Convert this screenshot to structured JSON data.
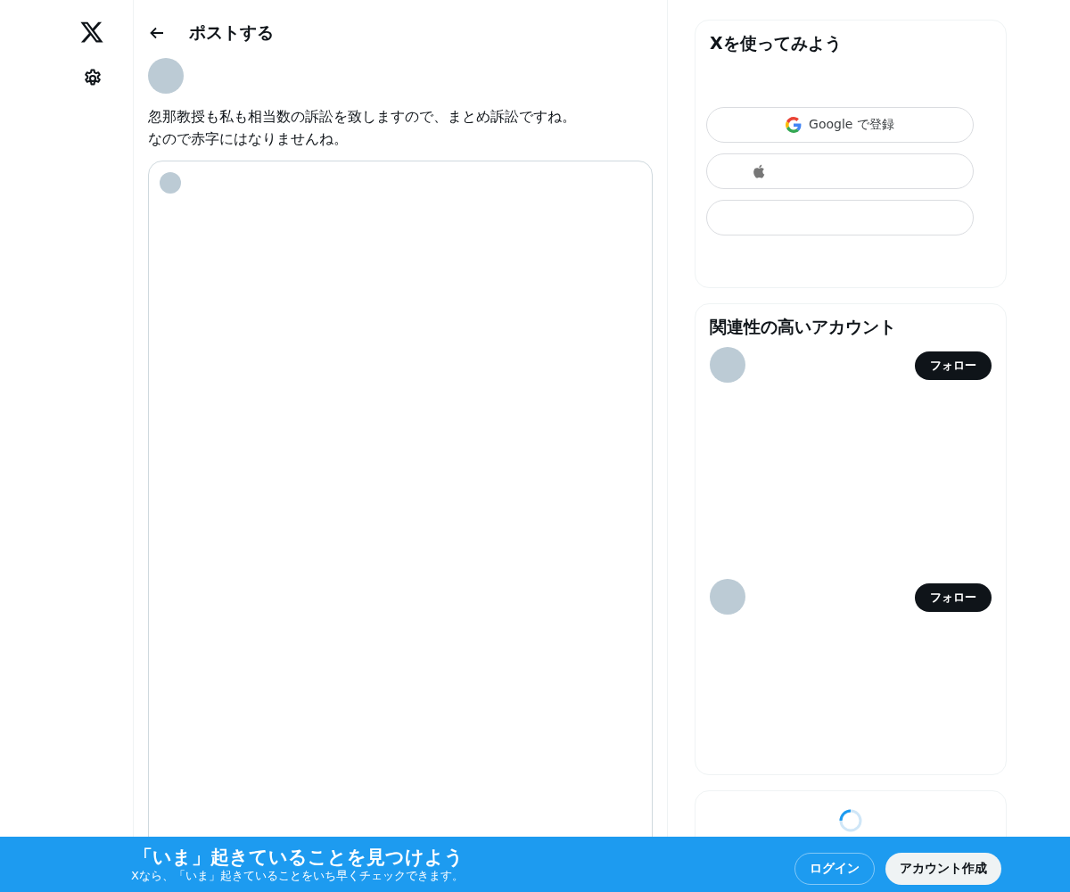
{
  "header": {
    "title": "ポストする"
  },
  "post": {
    "text_lines": [
      "忽那教授も私も相当数の訴訟を致しますので、まとめ訴訟ですね。",
      "なので赤字にはなりませんね。"
    ]
  },
  "signup_card": {
    "title": "Xを使ってみよう",
    "buttons": [
      {
        "kind": "google",
        "label": "Google で登録"
      },
      {
        "kind": "apple"
      },
      {
        "kind": "blank"
      }
    ]
  },
  "accounts_card": {
    "title": "関連性の高いアカウント",
    "accounts": [
      {
        "button": "フォロー"
      },
      {
        "button": "フォロー"
      }
    ]
  },
  "banner": {
    "title": "「いま」起きていることを見つけよう",
    "subtitle": "Xなら、「いま」起きていることをいち早くチェックできます。",
    "login": "ログイン",
    "signup": "アカウント作成"
  }
}
